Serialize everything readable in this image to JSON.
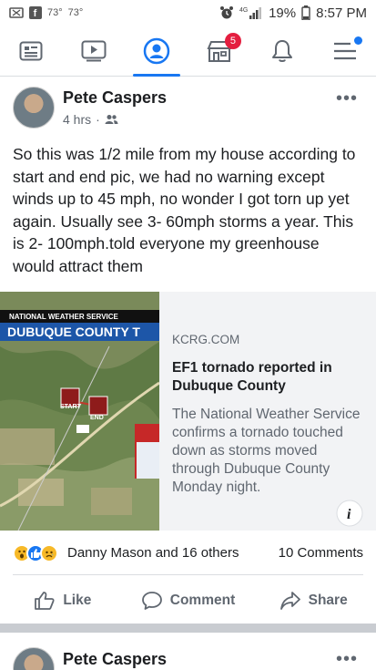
{
  "status_bar": {
    "temp1": "73°",
    "temp2": "73°",
    "network": "4G",
    "battery": "19%",
    "time": "8:57 PM"
  },
  "nav": {
    "items": [
      {
        "name": "news-feed",
        "icon": "newspaper-icon"
      },
      {
        "name": "watch",
        "icon": "video-play-icon"
      },
      {
        "name": "profile",
        "icon": "profile-icon",
        "active": true
      },
      {
        "name": "marketplace",
        "icon": "shop-icon",
        "badge": "5"
      },
      {
        "name": "notifications",
        "icon": "bell-icon"
      },
      {
        "name": "menu",
        "icon": "menu-icon"
      }
    ],
    "accent": "#1877f2"
  },
  "post": {
    "author": "Pete Caspers",
    "time": "4 hrs",
    "more": "•••",
    "text": "So this was 1/2 mile from my house according to start and end pic, we had no warning except winds up to 45 mph, no wonder I got torn up yet again. Usually see 3- 60mph storms a year. This is 2- 100mph.told everyone my greenhouse would attract them",
    "link": {
      "banner_top": "NATIONAL WEATHER SERVICE",
      "banner_main": "DUBUQUE COUNTY T",
      "map_start": "START",
      "map_end": "END",
      "domain": "KCRG.COM",
      "title": "EF1 tornado reported in Dubuque County",
      "description": "The National Weather Service confirms a tornado touched down as storms moved through Dubuque County Monday night.",
      "info": "i"
    },
    "reactions": {
      "names": "Danny Mason and 16 others",
      "comments": "10 Comments"
    },
    "actions": {
      "like": "Like",
      "comment": "Comment",
      "share": "Share"
    }
  },
  "next_post": {
    "author": "Pete Caspers",
    "more": "•••"
  }
}
